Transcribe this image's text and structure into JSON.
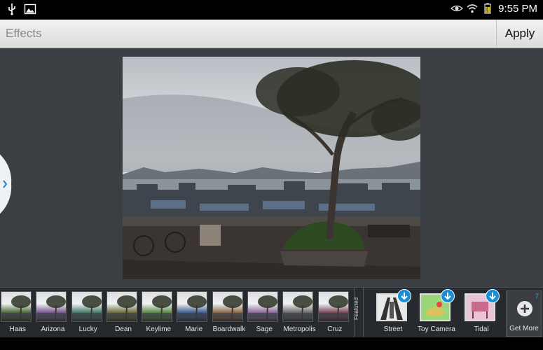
{
  "status_bar": {
    "time": "9:55 PM",
    "left_icons": [
      "usb-icon",
      "image-notification-icon"
    ],
    "right_icons": [
      "eye-icon",
      "wifi-icon",
      "battery-icon"
    ]
  },
  "action_bar": {
    "title": "Effects",
    "apply_label": "Apply"
  },
  "filters": [
    {
      "label": "Haas",
      "tint": "#4d6b3c"
    },
    {
      "label": "Arizona",
      "tint": "#7a5a8e"
    },
    {
      "label": "Lucky",
      "tint": "#4a7a6a"
    },
    {
      "label": "Dean",
      "tint": "#6b6f3e"
    },
    {
      "label": "Keylime",
      "tint": "#5c8a4a"
    },
    {
      "label": "Marie",
      "tint": "#3f5f8e"
    },
    {
      "label": "Boardwalk",
      "tint": "#8a6a4a"
    },
    {
      "label": "Sage",
      "tint": "#8a6a9a"
    },
    {
      "label": "Metropolis",
      "tint": "#6a6a6a"
    },
    {
      "label": "Cruz",
      "tint": "#7a4a5a"
    }
  ],
  "featured_label": "Featured",
  "store_effects": [
    {
      "label": "Street"
    },
    {
      "label": "Toy Camera"
    },
    {
      "label": "Tidal"
    }
  ],
  "get_more": {
    "label": "Get More",
    "count": "7"
  },
  "colors": {
    "accent": "#1a8fd6",
    "canvas_bg": "#3b3f44",
    "strip_bg": "#26292d"
  }
}
